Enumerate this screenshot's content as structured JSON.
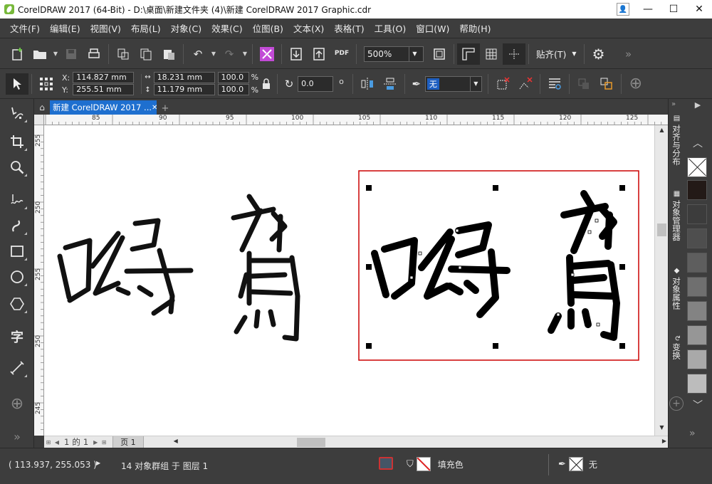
{
  "window": {
    "title": "CorelDRAW 2017 (64-Bit) - D:\\桌面\\新建文件夹 (4)\\新建 CorelDRAW 2017 Graphic.cdr",
    "minimize": "—",
    "maximize": "☐",
    "close": "✕"
  },
  "menu": [
    "文件(F)",
    "编辑(E)",
    "视图(V)",
    "布局(L)",
    "对象(C)",
    "效果(C)",
    "位图(B)",
    "文本(X)",
    "表格(T)",
    "工具(O)",
    "窗口(W)",
    "帮助(H)"
  ],
  "toolbar": {
    "pdf_label": "PDF",
    "zoom_value": "500%",
    "snap_label": "贴齐(T)"
  },
  "properties": {
    "x_label": "X:",
    "y_label": "Y:",
    "x_value": "114.827 mm",
    "y_value": "255.51 mm",
    "width_value": "18.231 mm",
    "height_value": "11.179 mm",
    "scale_w": "100.0",
    "scale_h": "100.0",
    "percent": "%",
    "rotation": "0.0",
    "degree": "o",
    "outline_width": "无"
  },
  "document_tab": {
    "label": "新建 CorelDRAW 2017 ...",
    "close": "✕"
  },
  "ruler": {
    "h_ticks": [
      "85",
      "90",
      "95",
      "100",
      "105",
      "110",
      "115",
      "120",
      "125"
    ],
    "v_ticks": [
      "255",
      "250",
      "255",
      "250",
      "245"
    ]
  },
  "pager": {
    "page_current": "1",
    "of": "的",
    "page_total": "1",
    "page_tab": "页 1"
  },
  "dockers": [
    {
      "icon": "align-icon",
      "label": "对齐与分布"
    },
    {
      "icon": "objects-icon",
      "label": "对象管理器"
    },
    {
      "icon": "properties-icon",
      "label": "对象属性"
    },
    {
      "icon": "transform-icon",
      "label": "变换"
    }
  ],
  "palette": {
    "colors": [
      "#231a17",
      "#3c3c3c",
      "#4e4e4e",
      "#5e5e5e",
      "#6f6f6f",
      "#838383",
      "#969696",
      "#a9a9a9",
      "#bcbcbc",
      "#d2d2d2",
      "#e6e6e6"
    ]
  },
  "status": {
    "coords": "( 113.937, 255.053 )",
    "info": "14 对象群组 于 图层 1",
    "fill_label": "填充色",
    "outline_label": "无"
  },
  "colors": {
    "selection_frame": "#cc0000",
    "active_tab": "#1e6fcf"
  }
}
